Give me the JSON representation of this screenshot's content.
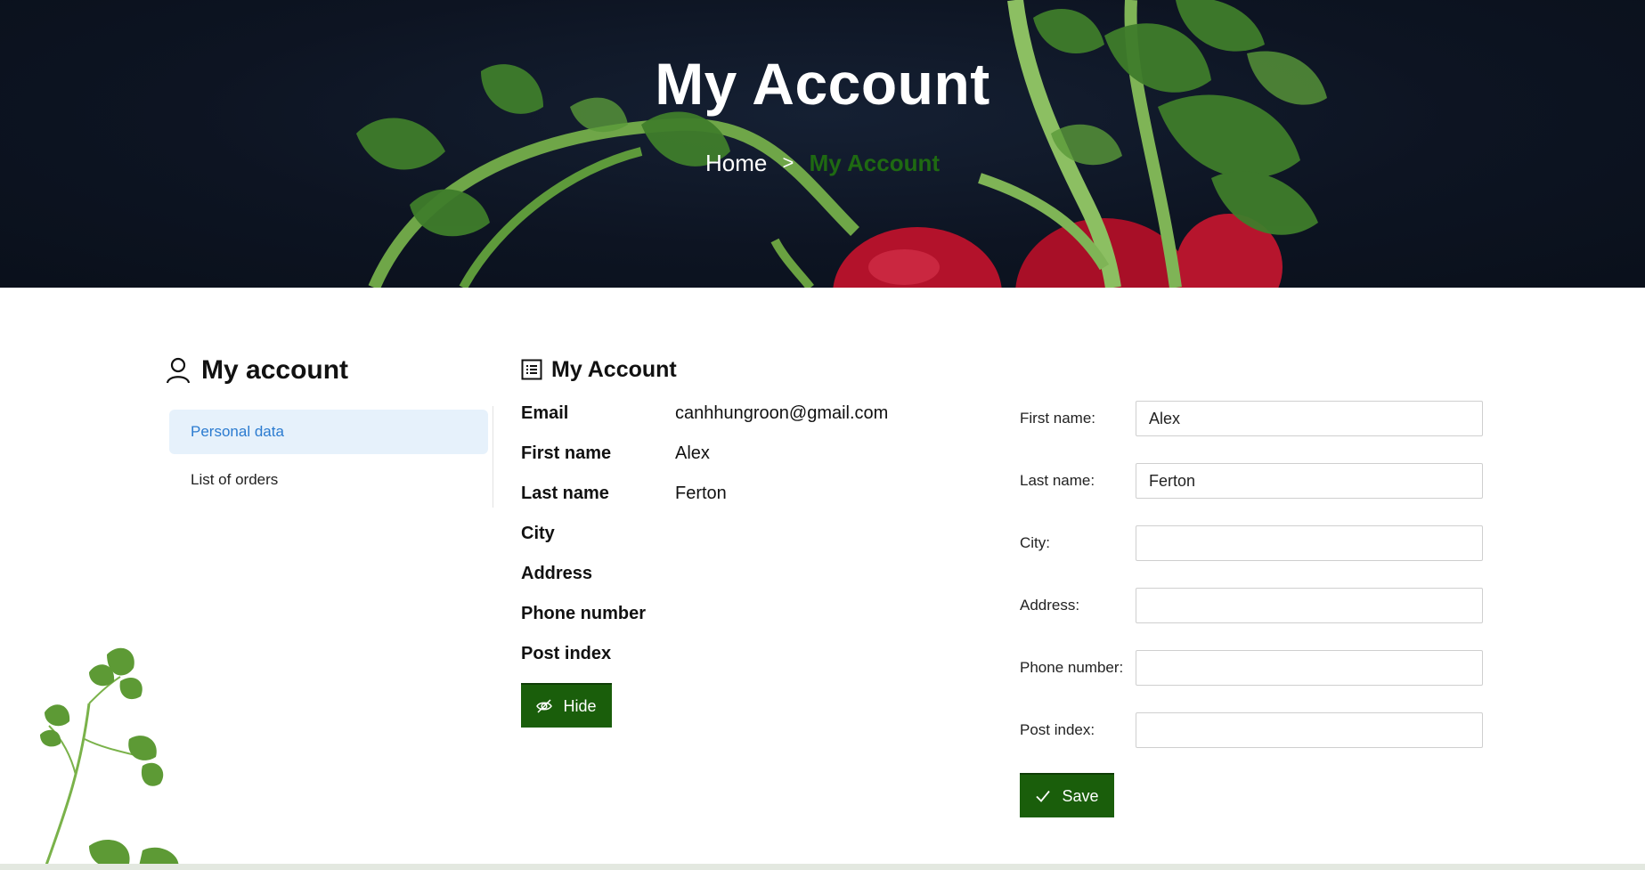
{
  "hero": {
    "title": "My Account",
    "breadcrumb": {
      "home": "Home",
      "separator": ">",
      "current": "My Account"
    }
  },
  "sidebar": {
    "title": "My account",
    "items": [
      {
        "label": "Personal data",
        "active": true
      },
      {
        "label": "List of orders",
        "active": false
      }
    ]
  },
  "info": {
    "title": "My Account",
    "rows": [
      {
        "label": "Email",
        "value": "canhhungroon@gmail.com"
      },
      {
        "label": "First name",
        "value": "Alex"
      },
      {
        "label": "Last name",
        "value": "Ferton"
      },
      {
        "label": "City",
        "value": ""
      },
      {
        "label": "Address",
        "value": ""
      },
      {
        "label": "Phone number",
        "value": ""
      },
      {
        "label": "Post index",
        "value": ""
      }
    ],
    "hide_label": "Hide"
  },
  "form": {
    "fields": [
      {
        "label": "First name:",
        "value": "Alex"
      },
      {
        "label": "Last name:",
        "value": "Ferton"
      },
      {
        "label": "City:",
        "value": ""
      },
      {
        "label": "Address:",
        "value": ""
      },
      {
        "label": "Phone number:",
        "value": ""
      },
      {
        "label": "Post index:",
        "value": ""
      }
    ],
    "save_label": "Save"
  },
  "colors": {
    "accent_green": "#1a5e0b",
    "breadcrumb_current": "#1f6a12",
    "active_item_bg": "#e6f1fb",
    "active_item_text": "#2b7bd0"
  },
  "icons": {
    "sidebar_title": "user-icon",
    "info_title": "list-icon",
    "hide_button": "eye-off-icon",
    "save_button": "check-icon"
  }
}
